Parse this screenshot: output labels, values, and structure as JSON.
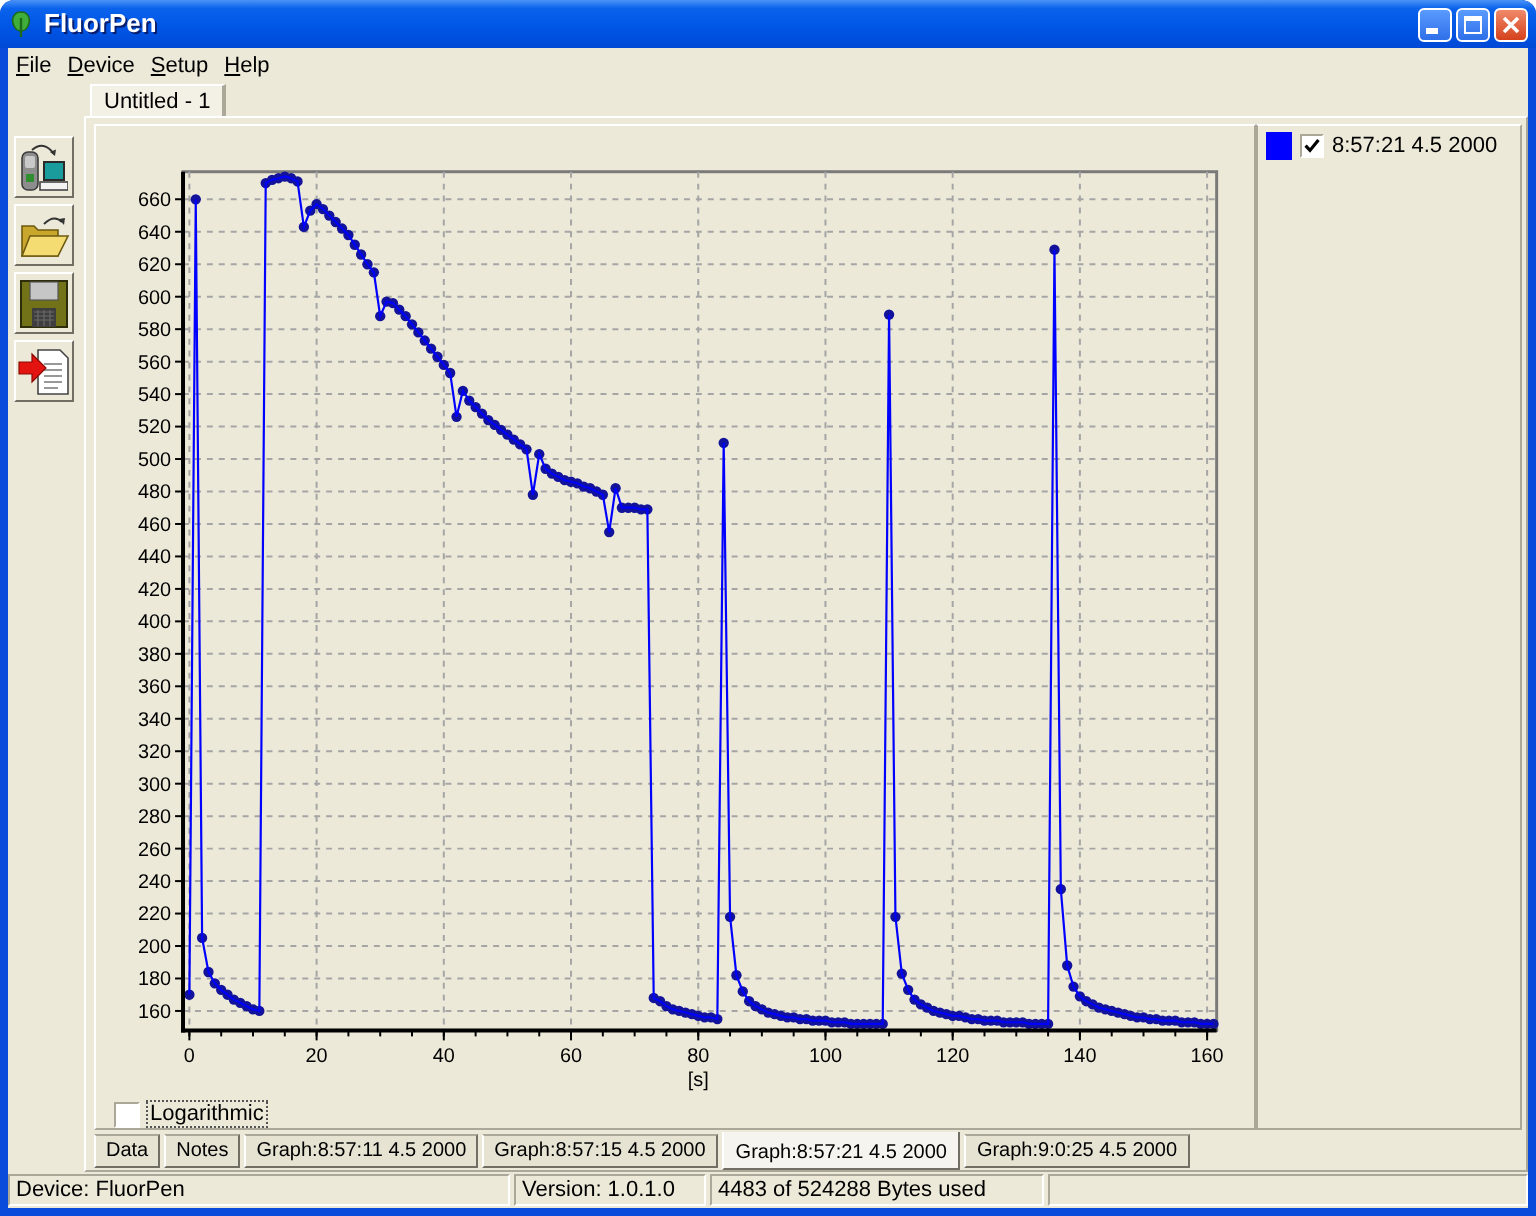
{
  "window": {
    "title": "FluorPen"
  },
  "menu": [
    {
      "label": "File"
    },
    {
      "label": "Device"
    },
    {
      "label": "Setup"
    },
    {
      "label": "Help"
    }
  ],
  "document_tabs": [
    {
      "label": "Untitled - 1",
      "selected": true
    }
  ],
  "chart": {
    "chart_data": {
      "type": "line",
      "xlabel": "[s]",
      "grid": true,
      "x": [
        0,
        1,
        2,
        3,
        4,
        5,
        6,
        7,
        8,
        9,
        10,
        11,
        12,
        13,
        14,
        15,
        16,
        17,
        18,
        19,
        20,
        21,
        22,
        23,
        24,
        25,
        26,
        27,
        28,
        29,
        30,
        31,
        32,
        33,
        34,
        35,
        36,
        37,
        38,
        39,
        40,
        41,
        42,
        43,
        44,
        45,
        46,
        47,
        48,
        49,
        50,
        51,
        52,
        53,
        54,
        55,
        56,
        57,
        58,
        59,
        60,
        61,
        62,
        63,
        64,
        65,
        66,
        67,
        68,
        69,
        70,
        71,
        72,
        73,
        74,
        75,
        76,
        77,
        78,
        79,
        80,
        81,
        82,
        83,
        84,
        85,
        86,
        87,
        88,
        89,
        90,
        91,
        92,
        93,
        94,
        95,
        96,
        97,
        98,
        99,
        100,
        101,
        102,
        103,
        104,
        105,
        106,
        107,
        108,
        109,
        110,
        111,
        112,
        113,
        114,
        115,
        116,
        117,
        118,
        119,
        120,
        121,
        122,
        123,
        124,
        125,
        126,
        127,
        128,
        129,
        130,
        131,
        132,
        133,
        134,
        135,
        136,
        137,
        138,
        139,
        140,
        141,
        142,
        143,
        144,
        145,
        146,
        147,
        148,
        149,
        150,
        151,
        152,
        153,
        154,
        155,
        156,
        157,
        158,
        159,
        160,
        161
      ],
      "series": [
        {
          "name": "8:57:21 4.5 2000",
          "color": "#0000ff",
          "marker": "circle",
          "values": [
            170,
            660,
            205,
            184,
            177,
            173,
            170,
            167,
            165,
            163,
            161,
            160,
            670,
            672,
            673,
            674,
            673,
            671,
            643,
            653,
            657,
            654,
            650,
            646,
            642,
            638,
            632,
            626,
            620,
            615,
            588,
            597,
            596,
            592,
            588,
            583,
            578,
            573,
            568,
            563,
            558,
            553,
            526,
            542,
            536,
            532,
            528,
            524,
            521,
            518,
            515,
            512,
            509,
            506,
            478,
            503,
            494,
            491,
            489,
            487,
            486,
            485,
            483,
            482,
            480,
            478,
            455,
            482,
            470,
            470,
            470,
            469,
            469,
            168,
            166,
            163,
            161,
            160,
            159,
            158,
            157,
            156,
            156,
            155,
            510,
            218,
            182,
            172,
            166,
            163,
            161,
            159,
            158,
            157,
            156,
            156,
            155,
            155,
            154,
            154,
            154,
            153,
            153,
            153,
            152,
            152,
            152,
            152,
            152,
            152,
            589,
            218,
            183,
            173,
            167,
            164,
            162,
            160,
            159,
            158,
            157,
            157,
            156,
            155,
            155,
            154,
            154,
            154,
            153,
            153,
            153,
            153,
            152,
            152,
            152,
            152,
            629,
            235,
            188,
            175,
            169,
            166,
            164,
            162,
            161,
            160,
            159,
            158,
            157,
            156,
            156,
            155,
            155,
            154,
            154,
            154,
            153,
            153,
            153,
            152,
            152,
            152
          ]
        }
      ],
      "xlim": [
        -1,
        161.5
      ],
      "ylim": [
        148,
        677
      ],
      "xticks": [
        0,
        20,
        40,
        60,
        80,
        100,
        120,
        140,
        160
      ],
      "yticks": [
        160,
        180,
        200,
        220,
        240,
        260,
        280,
        300,
        320,
        340,
        360,
        380,
        400,
        420,
        440,
        460,
        480,
        500,
        520,
        540,
        560,
        580,
        600,
        620,
        640,
        660
      ]
    },
    "legend": [
      {
        "checked": true
      }
    ],
    "logarithmic": {
      "label": "Logarithmic",
      "checked": false
    }
  },
  "bottom_tabs": [
    {
      "label": "Data",
      "selected": false
    },
    {
      "label": "Notes",
      "selected": false
    },
    {
      "label": "Graph:8:57:11 4.5 2000",
      "selected": false
    },
    {
      "label": "Graph:8:57:15 4.5 2000",
      "selected": false
    },
    {
      "label": "Graph:8:57:21 4.5 2000",
      "selected": true
    },
    {
      "label": "Graph:9:0:25 4.5 2000",
      "selected": false
    }
  ],
  "status_bar": [
    "Device: FluorPen",
    "Version: 1.0.1.0",
    "4483 of 524288 Bytes used"
  ]
}
